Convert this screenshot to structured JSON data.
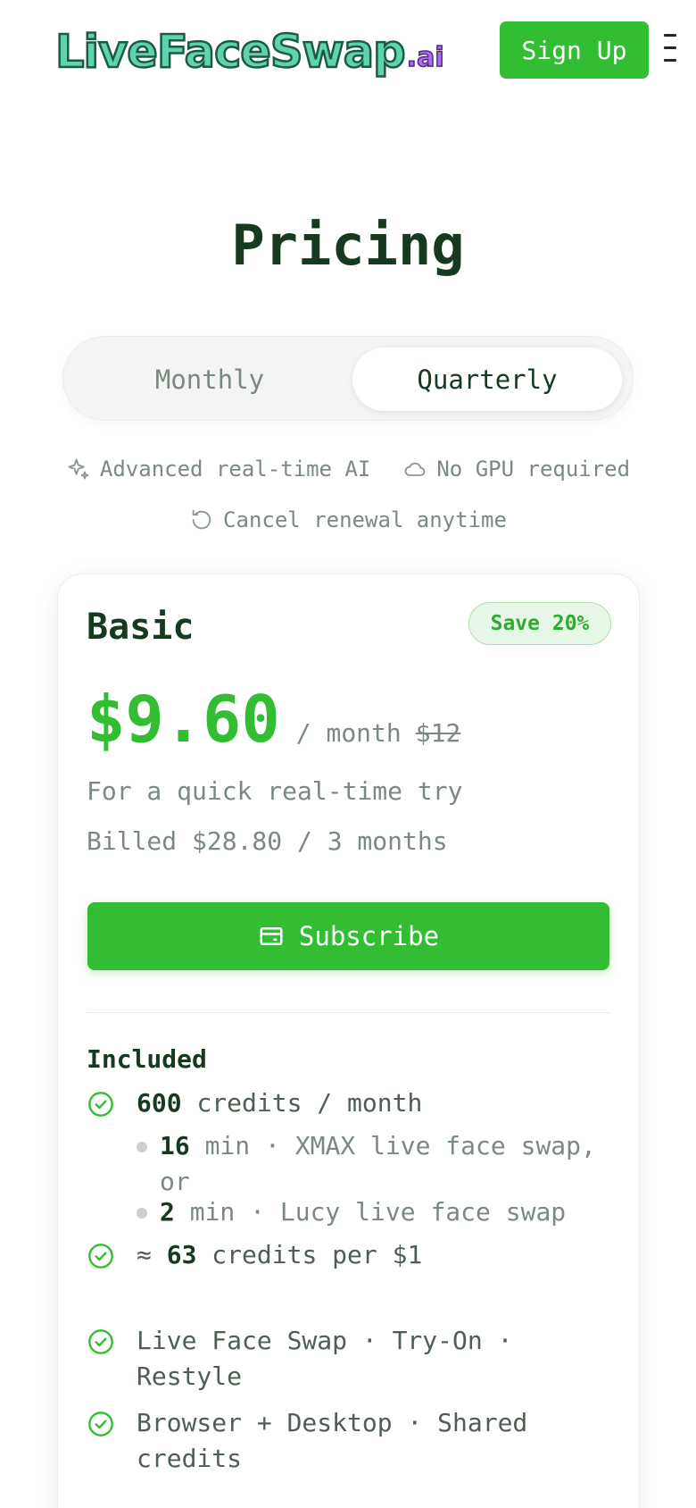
{
  "header": {
    "logo_main": "LiveFaceSwap",
    "logo_ai": ".ai",
    "signup_label": "Sign Up"
  },
  "page_title": "Pricing",
  "billing_toggle": {
    "options": [
      "Monthly",
      "Quarterly"
    ],
    "selected": "Quarterly"
  },
  "features": [
    {
      "icon": "sparkles-icon",
      "label": "Advanced real-time AI"
    },
    {
      "icon": "cloud-icon",
      "label": "No GPU required"
    },
    {
      "icon": "refresh-icon",
      "label": "Cancel renewal anytime"
    }
  ],
  "plan": {
    "name": "Basic",
    "badge": "Save 20%",
    "price": "$9.60",
    "period": "/ month",
    "old_price": "$12",
    "description": "For a quick real-time try",
    "billed": "Billed $28.80 / 3 months",
    "subscribe_label": "Subscribe",
    "included_heading": "Included",
    "credits_value": "600",
    "credits_text": "credits / month",
    "sub_items": [
      {
        "value": "16",
        "text": "min · XMAX live face swap, or"
      },
      {
        "value": "2",
        "text": "min · Lucy live face swap"
      }
    ],
    "rate_prefix": "≈",
    "rate_value": "63",
    "rate_text": "credits per $1",
    "extras": [
      "Live Face Swap · Try-On · Restyle",
      "Browser + Desktop · Shared credits"
    ]
  },
  "colors": {
    "accent": "#32bd32",
    "heading": "#16391f",
    "muted": "#7a8a80"
  }
}
